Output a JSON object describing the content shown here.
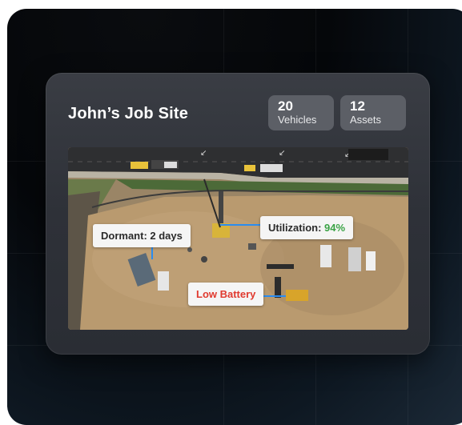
{
  "site": {
    "title": "John’s Job Site"
  },
  "stats": {
    "vehicles": {
      "count": "20",
      "label": "Vehicles"
    },
    "assets": {
      "count": "12",
      "label": "Assets"
    }
  },
  "tags": {
    "dormant": "Dormant: 2 days",
    "utilization_label": "Utilization: ",
    "utilization_value": "94%",
    "low_battery": "Low Battery"
  },
  "colors": {
    "utilization_green": "#3aa345",
    "alert_red": "#e03a2f",
    "connector_blue": "#2a8cf0"
  }
}
